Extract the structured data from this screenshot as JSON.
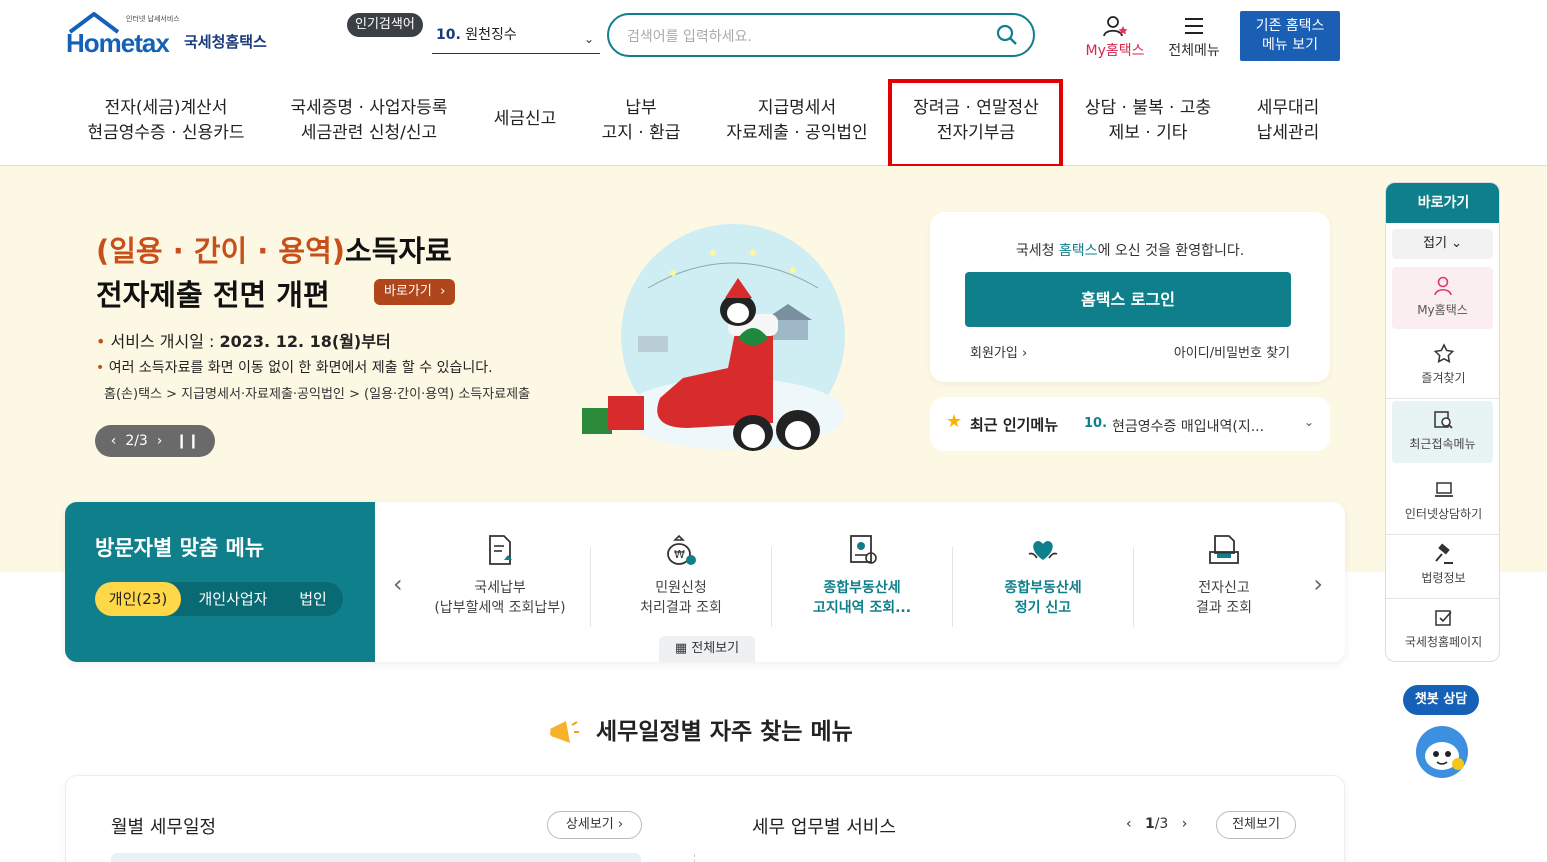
{
  "header": {
    "logo_small": "인터넷 납세서비스",
    "logo_brand": "Hometax",
    "logo_kor": "국세청홈택스",
    "popular_badge": "인기검색어",
    "popular_num": "10.",
    "popular_term": "원천징수",
    "search_placeholder": "검색어를 입력하세요.",
    "my_hometax": "My홈택스",
    "all_menu": "전체메뉴",
    "old_menu_line1": "기존 홈택스",
    "old_menu_line2": "메뉴 보기"
  },
  "gnb": [
    {
      "line1": "전자(세금)계산서",
      "line2": "현금영수증 · 신용카드"
    },
    {
      "line1": "국세증명 · 사업자등록",
      "line2": "세금관련 신청/신고"
    },
    {
      "line1": "세금신고",
      "line2": ""
    },
    {
      "line1": "납부",
      "line2": "고지 · 환급"
    },
    {
      "line1": "지급명세서",
      "line2": "자료제출 · 공익법인"
    },
    {
      "line1": "장려금 · 연말정산",
      "line2": "전자기부금"
    },
    {
      "line1": "상담 · 불복 · 고충",
      "line2": "제보 · 기타"
    },
    {
      "line1": "세무대리",
      "line2": "납세관리"
    }
  ],
  "hero": {
    "title_highlight": "(일용 · 간이 · 용역)",
    "title_rest": "소득자료",
    "title2": "전자제출 전면 개편",
    "go_button": "바로가기",
    "bullet1_label": "서비스 개시일 :",
    "bullet1_value": "2023. 12. 18(월)부터",
    "bullet2": "여러 소득자료를 화면 이동 없이 한 화면에서 제출 할 수 있습니다.",
    "path": "홈(손)택스 > 지급명세서·자료제출·공익법인 > (일용·간이·용역) 소득자료제출",
    "pager": "2/3"
  },
  "login": {
    "welcome_pre": "국세청 ",
    "welcome_brand": "홈택스",
    "welcome_post": "에 오신 것을 환영합니다.",
    "button": "홈택스 로그인",
    "join": "회원가입",
    "find": "아이디/비밀번호 찾기"
  },
  "popular_menu": {
    "label": "최근 인기메뉴",
    "num": "10.",
    "value": "현금영수증 매입내역(지..."
  },
  "quick": {
    "title": "바로가기",
    "fold": "접기",
    "items": [
      "My홈택스",
      "즐겨찾기",
      "최근접속메뉴",
      "인터넷상담하기",
      "법령정보",
      "국세청홈페이지"
    ]
  },
  "chatbot": {
    "label": "챗봇 상담"
  },
  "visitor": {
    "title": "방문자별 맞춤 메뉴",
    "tabs": [
      "개인(23)",
      "개인사업자",
      "법인"
    ],
    "items": [
      {
        "line1": "국세납부",
        "line2": "(납부할세액 조회납부)"
      },
      {
        "line1": "민원신청",
        "line2": "처리결과 조회"
      },
      {
        "line1": "종합부동산세",
        "line2": "고지내역 조회..."
      },
      {
        "line1": "종합부동산세",
        "line2": "정기 신고"
      },
      {
        "line1": "전자신고",
        "line2": "결과 조회"
      }
    ],
    "all": "전체보기"
  },
  "schedule": {
    "title": "세무일정별 자주 찾는 메뉴",
    "monthly": "월별 세무일정",
    "detail": "상세보기",
    "work_title": "세무 업무별 서비스",
    "page_current": "1",
    "page_total": "/3",
    "all": "전체보기"
  },
  "colors": {
    "teal": "#0f7f8c",
    "brand_blue": "#1661b8",
    "highlight_red": "#e30000",
    "hero_bg": "#fdf8e4"
  }
}
